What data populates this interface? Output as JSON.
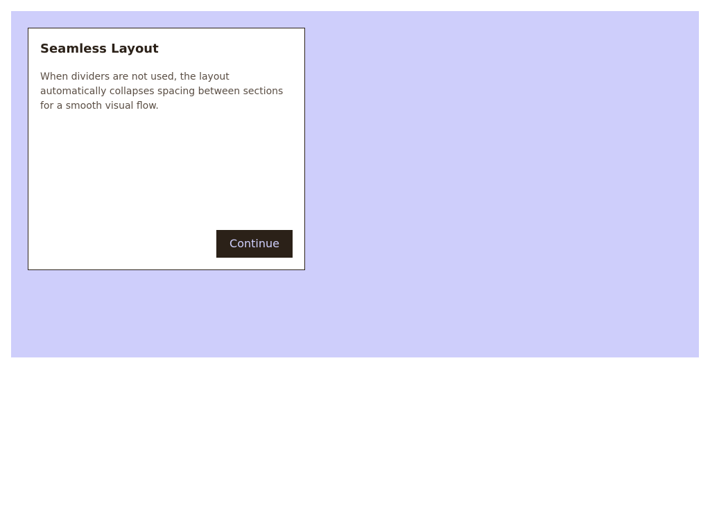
{
  "dialog": {
    "title": "Seamless Layout",
    "body": "When dividers are not used, the layout automatically collapses spacing between sections for a smooth visual flow.",
    "continue_label": "Continue"
  },
  "colors": {
    "backdrop": "#cecefb",
    "card_background": "#ffffff",
    "title_text": "#2b2118",
    "body_text": "#5a4e44",
    "button_background": "#2b2118",
    "button_text": "#cecefb"
  }
}
